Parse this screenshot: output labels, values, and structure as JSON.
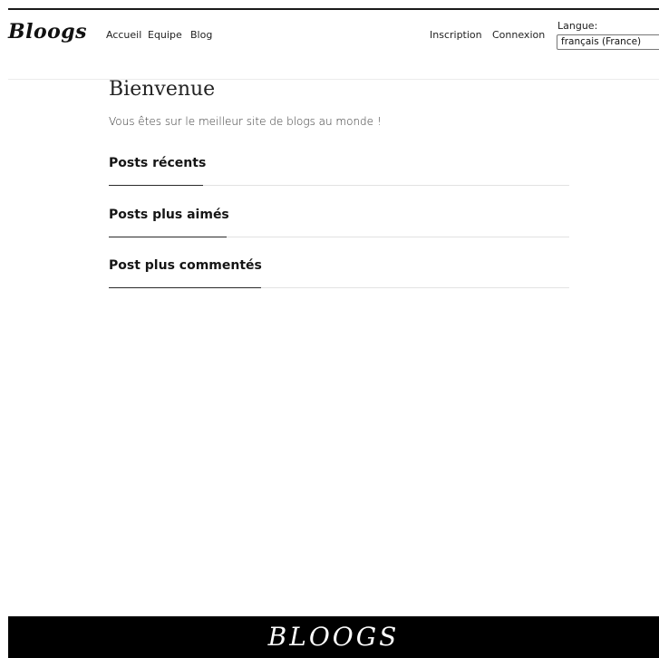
{
  "header": {
    "brand": "Bloogs",
    "nav_left": [
      "Accueil",
      "Equipe",
      "Blog"
    ],
    "nav_right": [
      "Inscription",
      "Connexion"
    ],
    "language": {
      "label": "Langue:",
      "selected": "français (France)"
    }
  },
  "main": {
    "title": "Bienvenue",
    "subtitle": "Vous êtes sur le meilleur site de blogs au monde !",
    "sections": [
      "Posts récents",
      "Posts plus aimés",
      "Post plus commentés"
    ]
  },
  "footer": {
    "logo": "BLOOGS"
  }
}
